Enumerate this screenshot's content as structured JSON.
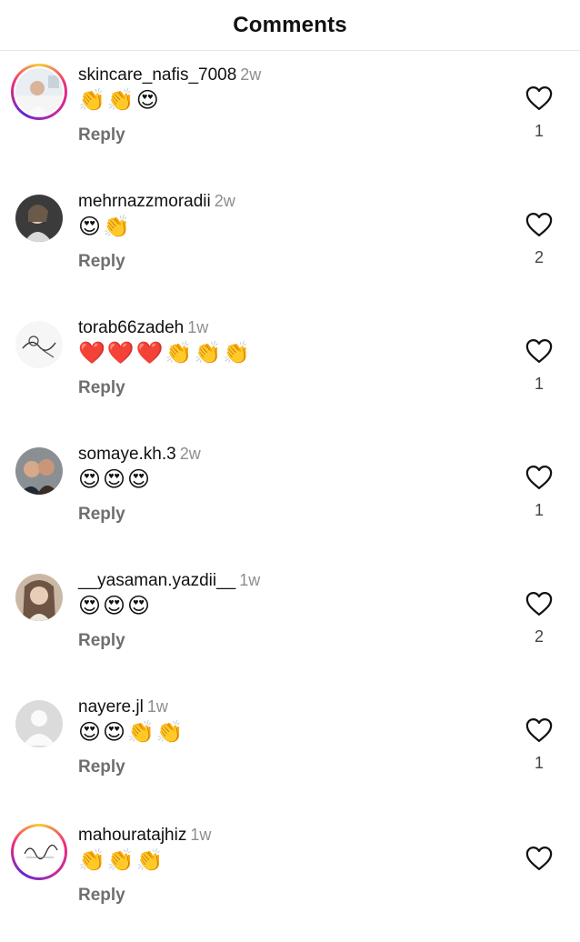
{
  "header": {
    "title": "Comments"
  },
  "reply_label": "Reply",
  "comments": [
    {
      "username": "skincare_nafis_7008",
      "time": "2w",
      "text": "👏👏😍",
      "likes": "1",
      "story_ring": true,
      "avatar_style": "photo-light"
    },
    {
      "username": "mehrnazzmoradii",
      "time": "2w",
      "text": "😍👏",
      "likes": "2",
      "story_ring": false,
      "avatar_style": "photo-dark"
    },
    {
      "username": "torab66zadeh",
      "time": "1w",
      "text": "❤️❤️❤️👏👏👏",
      "likes": "1",
      "story_ring": false,
      "avatar_style": "sketch"
    },
    {
      "username": "somaye.kh.3",
      "time": "2w",
      "text": "😍😍😍",
      "likes": "1",
      "story_ring": false,
      "avatar_style": "photo-group"
    },
    {
      "username": "__yasaman.yazdii__",
      "time": "1w",
      "text": "😍😍😍",
      "likes": "2",
      "story_ring": false,
      "avatar_style": "photo-beige"
    },
    {
      "username": "nayere.jl",
      "time": "1w",
      "text": "😍😍👏👏",
      "likes": "1",
      "story_ring": false,
      "avatar_style": "default"
    },
    {
      "username": "mahouratajhiz",
      "time": "1w",
      "text": "👏👏👏",
      "likes": "",
      "story_ring": true,
      "avatar_style": "logo"
    }
  ],
  "colors": {
    "muted": "#8e8e8e",
    "reply": "#6f6f6f",
    "divider": "#e6e6e6"
  },
  "icons": {
    "like": "heart-outline-icon"
  }
}
